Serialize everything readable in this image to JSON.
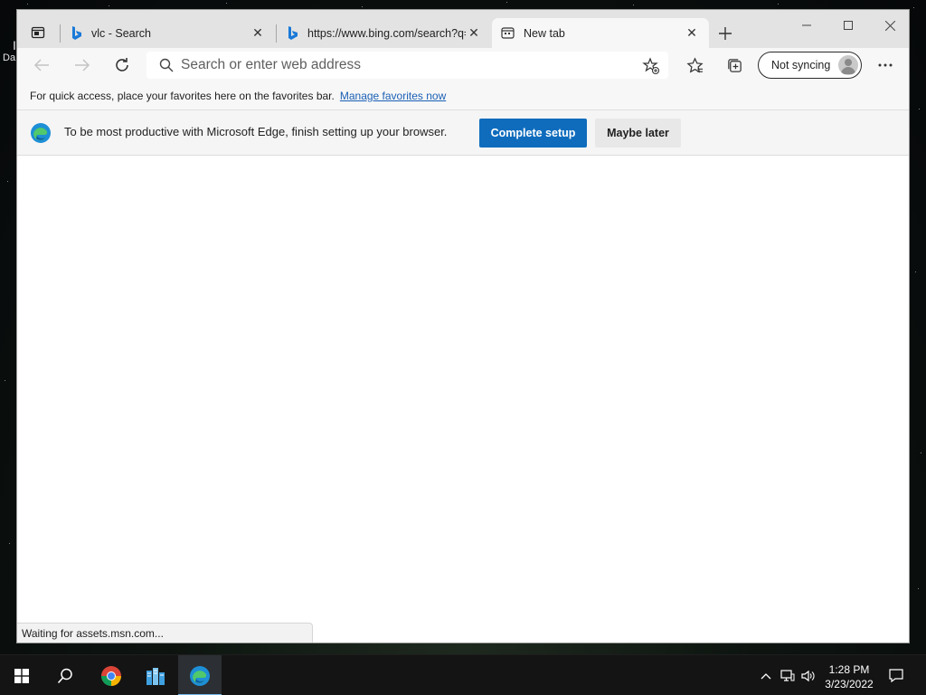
{
  "browser": {
    "tabs": [
      {
        "title": "vlc - Search",
        "icon": "bing-icon",
        "active": false
      },
      {
        "title": "https://www.bing.com/search?q=",
        "icon": "bing-icon",
        "active": false
      },
      {
        "title": "New tab",
        "icon": "newtab-page-icon",
        "active": true
      }
    ],
    "address_placeholder": "Search or enter web address",
    "sync_label": "Not syncing",
    "favorites_bar": {
      "message": "For quick access, place your favorites here on the favorites bar.",
      "link": "Manage favorites now"
    },
    "setup_bar": {
      "message": "To be most productive with Microsoft Edge, finish setting up your browser.",
      "primary": "Complete setup",
      "secondary": "Maybe later"
    },
    "status": "Waiting for assets.msn.com..."
  },
  "desktop": {
    "partial_labels": [
      "I",
      "Da"
    ]
  },
  "taskbar": {
    "apps": [
      "start-icon",
      "search-icon",
      "chrome-icon",
      "file-manager-icon",
      "edge-icon"
    ],
    "clock_time": "1:28 PM",
    "clock_date": "3/23/2022"
  },
  "colors": {
    "accent": "#0f6cbd",
    "link": "#1a5fb4",
    "taskbar": "#141414"
  }
}
